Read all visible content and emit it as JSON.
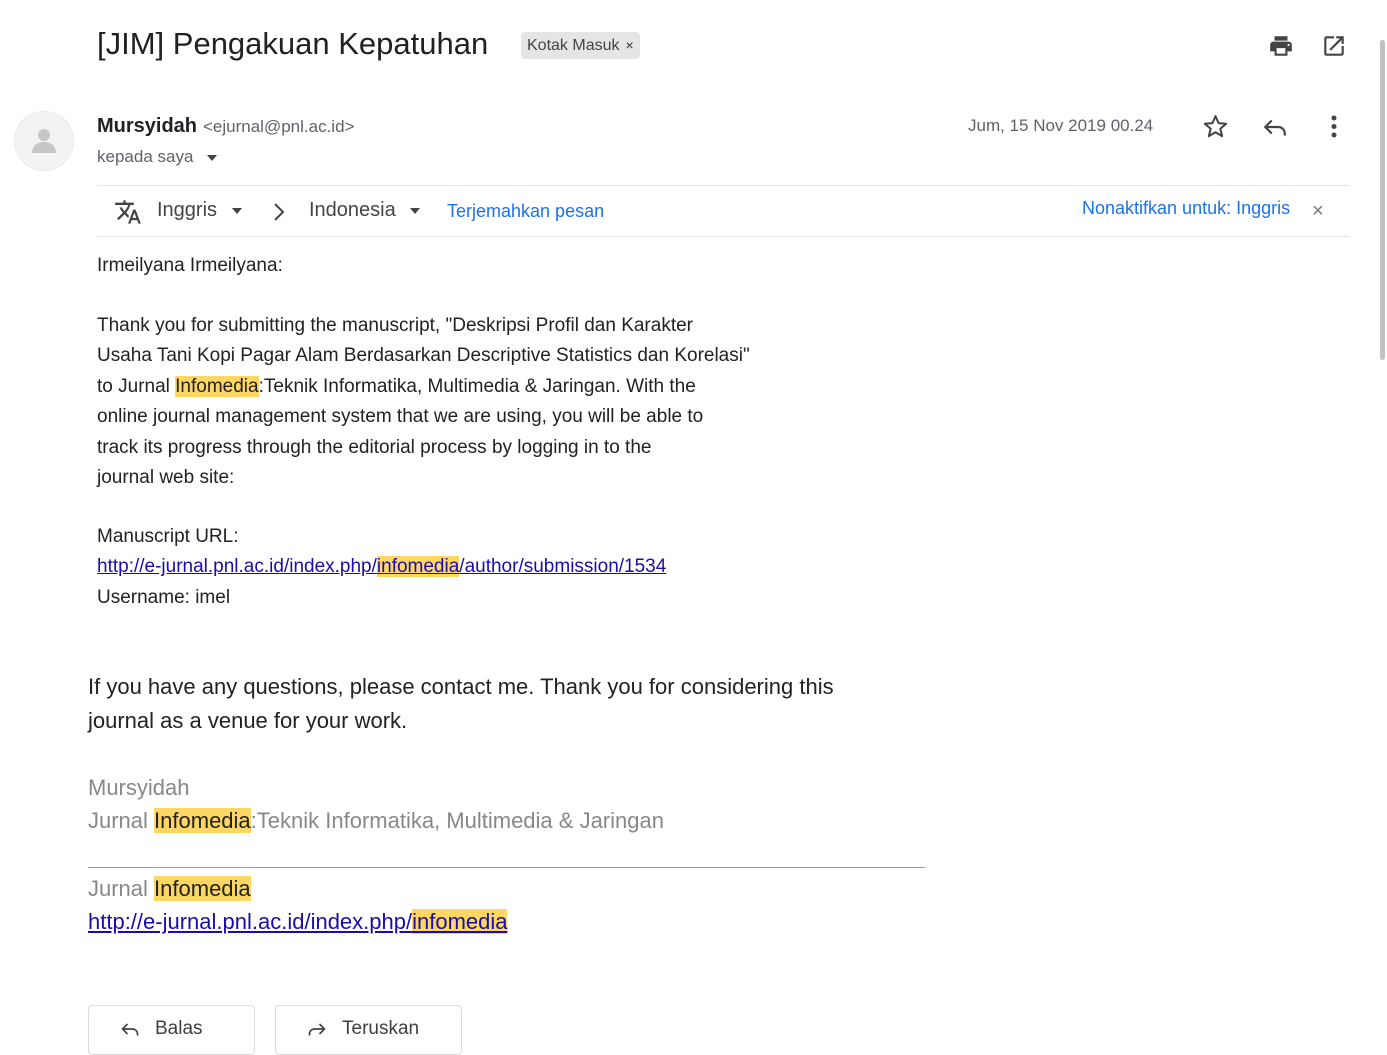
{
  "header": {
    "subject": "[JIM] Pengakuan Kepatuhan",
    "label": "Kotak Masuk",
    "label_remove": "×",
    "icons": [
      "print-icon",
      "open-in-new-window-icon"
    ]
  },
  "message": {
    "sender_name": "Mursyidah",
    "sender_email": "<ejurnal@pnl.ac.id>",
    "recipient": "kepada saya",
    "date": "Jum, 15 Nov 2019 00.24",
    "icons": [
      "star-icon",
      "reply-icon",
      "more-options-icon",
      "avatar-placeholder-icon"
    ]
  },
  "translate_bar": {
    "source_language": "Inggris",
    "arrow": "›",
    "target_language": "Indonesia",
    "translate_link": "Terjemahkan pesan",
    "disable_link": "Nonaktifkan untuk: Inggris",
    "close": "×"
  },
  "body": {
    "greeting": "Irmeilyana Irmeilyana:",
    "para1": [
      "Thank you for submitting the manuscript, \"Deskripsi Profil dan Karakter",
      "Usaha Tani Kopi Pagar Alam Berdasarkan Descriptive Statistics dan Korelasi\""
    ],
    "para1_l3_pre": "to Jurnal ",
    "highlight": "Infomedia",
    "para1_l3_post": ":Teknik Informatika, Multimedia & Jaringan. With the",
    "para1_rest": [
      "online journal management system that we are using, you will be able to",
      "track its progress through the editorial process by logging in to the",
      "journal web site:"
    ],
    "manuscript_label": "Manuscript URL:",
    "manuscript_url_pre": "http://e-jurnal.pnl.ac.id/index.php/",
    "manuscript_url_hl": "infomedia",
    "manuscript_url_post": "/author/submission/1534",
    "username": "Username: imel",
    "closing": [
      "If you have any questions, please contact me. Thank you for considering this",
      "journal as a venue for your work."
    ]
  },
  "signature": {
    "name": "Mursyidah",
    "journal_pre": "Jurnal ",
    "journal_post": ":Teknik Informatika, Multimedia & Jaringan",
    "footer_pre": "Jurnal ",
    "footer_url_pre": "http://e-jurnal.pnl.ac.id/index.php/",
    "footer_url_hl": "infomedia"
  },
  "actions": {
    "reply": "Balas",
    "forward": "Teruskan"
  },
  "colors": {
    "highlight": "#fdd663",
    "link": "#1a0dab",
    "translate_link": "#1a73e8"
  }
}
